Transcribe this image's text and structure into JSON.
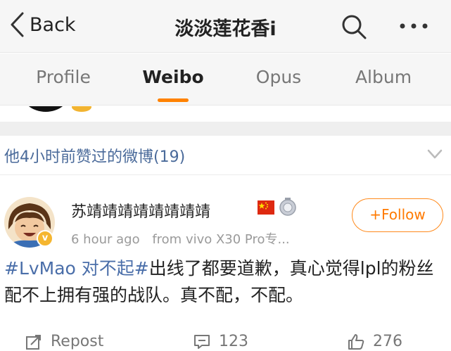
{
  "nav": {
    "back_label": "Back",
    "title": "淡淡莲花香i"
  },
  "tabs": [
    {
      "label": "Profile",
      "active": false
    },
    {
      "label": "Weibo",
      "active": true
    },
    {
      "label": "Opus",
      "active": false
    },
    {
      "label": "Album",
      "active": false
    }
  ],
  "liked_section": {
    "label": "他4小时前赞过的微博(19)"
  },
  "post": {
    "username": "苏靖靖靖靖靖靖靖靖",
    "verified": true,
    "time": "6 hour ago",
    "source": "from vivo X30 Pro专...",
    "follow_label": "+Follow",
    "hashtag": "#LvMao 对不起#",
    "text": "出线了都要道歉，真心觉得lpl的粉丝配不上拥有强的战队。真不配，不配。",
    "repost_label": "Repost",
    "comments": "123",
    "likes": "276"
  },
  "colors": {
    "accent": "#ff8200",
    "link": "#4a6ea9",
    "meta": "#9a9a9a",
    "bar_bg": "#f6f6f6"
  },
  "icons": [
    "chevron-left-icon",
    "search-icon",
    "more-icon",
    "chevron-down-icon",
    "china-flag-icon",
    "medal-icon",
    "verified-badge-icon",
    "repost-icon",
    "comment-icon",
    "like-icon"
  ]
}
